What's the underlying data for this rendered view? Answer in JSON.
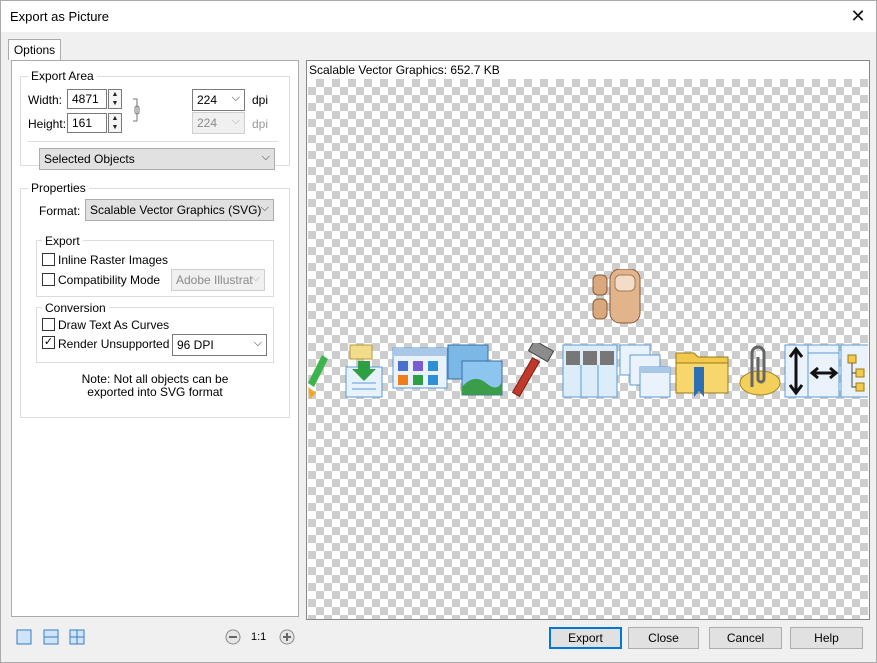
{
  "window": {
    "title": "Export as Picture"
  },
  "tabs": [
    {
      "label": "Options"
    }
  ],
  "export_area": {
    "label": "Export Area",
    "width_label": "Width:",
    "width_value": "4871",
    "height_label": "Height:",
    "height_value": "161",
    "dpi_value": "224",
    "dpi_unit": "dpi",
    "dpi2_value": "224",
    "dpi2_unit": "dpi",
    "scope_value": "Selected Objects"
  },
  "properties": {
    "label": "Properties",
    "format_label": "Format:",
    "format_value": "Scalable Vector Graphics (SVG)",
    "export_group": {
      "label": "Export",
      "inline_raster": {
        "label": "Inline Raster Images",
        "checked": false
      },
      "compat_mode": {
        "label": "Compatibility Mode",
        "checked": false
      },
      "compat_value": "Adobe Illustrat"
    },
    "conversion_group": {
      "label": "Conversion",
      "text_curves": {
        "label": "Draw Text As Curves",
        "checked": false
      },
      "render_unsupported": {
        "label": "Render Unsupported",
        "checked": true
      },
      "dpi_value": "96 DPI"
    },
    "note_line1": "Note: Not all objects can be",
    "note_line2": "exported into SVG format"
  },
  "preview": {
    "info": "Scalable Vector Graphics: 652.7 KB"
  },
  "zoom": {
    "ratio": "1:1"
  },
  "buttons": {
    "export": "Export",
    "close": "Close",
    "cancel": "Cancel",
    "help": "Help"
  },
  "colors": {
    "accent": "#0078d7",
    "icon_blue": "#5b9bd5",
    "icon_green": "#2ea043",
    "folder_yellow": "#f2c94c"
  }
}
